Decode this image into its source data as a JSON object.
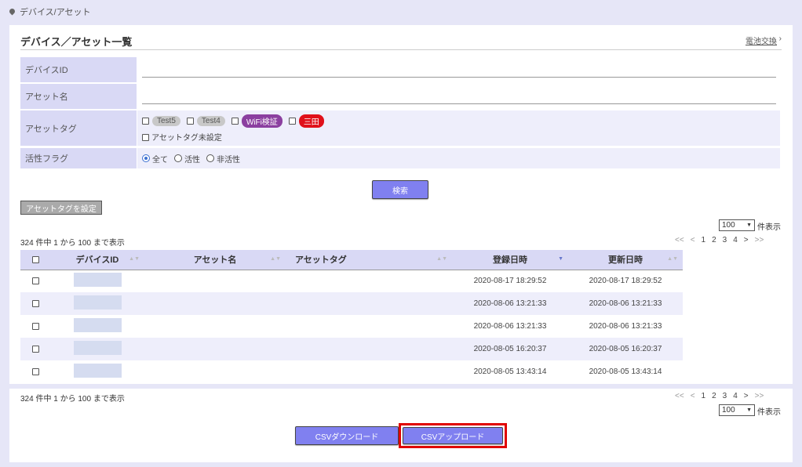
{
  "breadcrumb": "デバイス/アセット",
  "page_title": "デバイス／アセット一覧",
  "battery_link": "電池交換",
  "battery_chevron": "›",
  "form": {
    "device_id_label": "デバイスID",
    "device_id_value": "",
    "asset_name_label": "アセット名",
    "asset_name_value": "",
    "asset_tag_label": "アセットタグ",
    "tags": [
      {
        "name": "Test5",
        "bg": "#c8c8c8",
        "color": "#555555"
      },
      {
        "name": "Test4",
        "bg": "#c8c8c8",
        "color": "#555555"
      },
      {
        "name": "WiFi検証",
        "bg": "#8b3fa0",
        "color": "#ffffff"
      },
      {
        "name": "三田",
        "bg": "#e0101a",
        "color": "#ffffff"
      }
    ],
    "tag_unset_label": "アセットタグ未設定",
    "active_flag_label": "活性フラグ",
    "radio_all": "全て",
    "radio_active": "活性",
    "radio_inactive": "非活性"
  },
  "search_button": "検索",
  "set_tag_button": "アセットタグを設定",
  "per_page_value": "100",
  "per_page_label": "件表示",
  "count_text": "324 件中 1 から 100 まで表示",
  "pager": {
    "first": "<<",
    "prev": "<",
    "p1": "1",
    "p2": "2",
    "p3": "3",
    "p4": "4",
    "next": ">",
    "last": ">>"
  },
  "table": {
    "headers": {
      "device_id": "デバイスID",
      "asset_name": "アセット名",
      "asset_tag": "アセットタグ",
      "registered": "登録日時",
      "updated": "更新日時"
    },
    "rows": [
      {
        "registered": "2020-08-17 18:29:52",
        "updated": "2020-08-17 18:29:52"
      },
      {
        "registered": "2020-08-06 13:21:33",
        "updated": "2020-08-06 13:21:33"
      },
      {
        "registered": "2020-08-06 13:21:33",
        "updated": "2020-08-06 13:21:33"
      },
      {
        "registered": "2020-08-05 16:20:37",
        "updated": "2020-08-05 16:20:37"
      },
      {
        "registered": "2020-08-05 13:43:14",
        "updated": "2020-08-05 13:43:14"
      }
    ]
  },
  "csv_download": "CSVダウンロード",
  "csv_upload": "CSVアップロード",
  "colors": {
    "accent": "#8080f0",
    "highlight": "#e00000",
    "header_bg": "#d9d9f5"
  }
}
